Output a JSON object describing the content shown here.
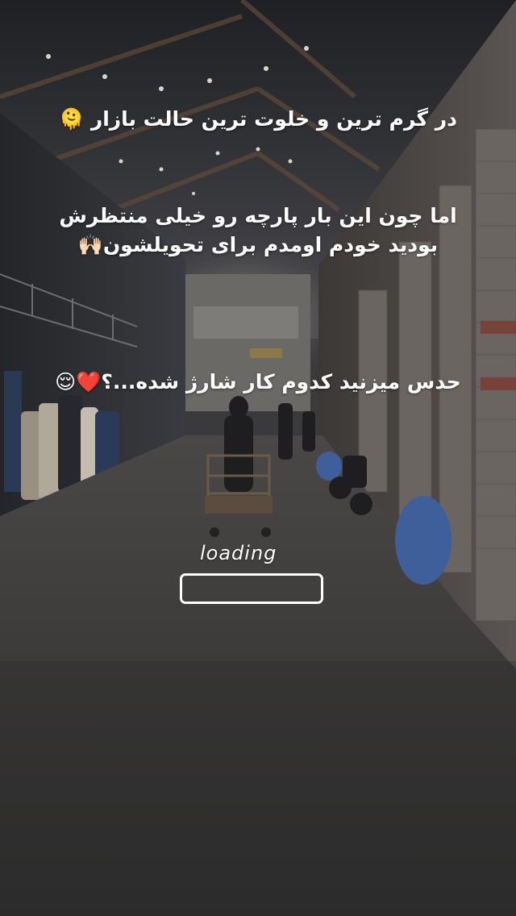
{
  "story": {
    "caption_1": "در گرم ترین و خلوت ترین حالت بازار 🫠",
    "caption_2": "اما چون این بار پارچه رو خیلی منتظرش\nبودید خودم اومدم برای تحویلشون🙌🏻",
    "caption_3": "حدس میزنید کدوم کار شارژ شده...؟❤️😌",
    "loading_label": "loading",
    "loading_progress": 0
  },
  "scene": {
    "description_icon": "bazaar-corridor-photo",
    "colors": {
      "roof": "#2b2c2f",
      "floor": "#3c3b3a",
      "wall_left": "#2f3034",
      "wall_right": "#4a4644",
      "shutter": "#6b6562",
      "bag_blue": "#3f5f9a",
      "text": "#ffffff"
    }
  }
}
